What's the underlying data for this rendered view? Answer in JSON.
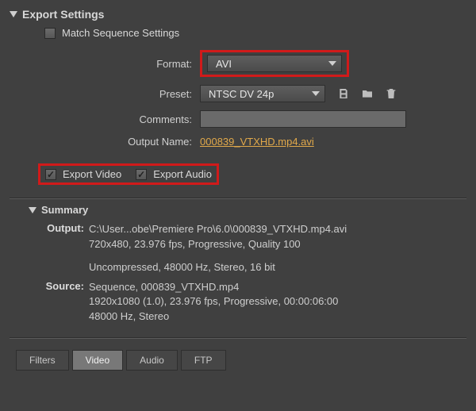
{
  "header": {
    "title": "Export Settings"
  },
  "matchSequence": {
    "label": "Match Sequence Settings",
    "checked": false
  },
  "format": {
    "label": "Format:",
    "value": "AVI"
  },
  "preset": {
    "label": "Preset:",
    "value": "NTSC DV 24p"
  },
  "presetIcons": {
    "save": "save-preset-icon",
    "import": "import-preset-icon",
    "delete": "delete-preset-icon"
  },
  "comments": {
    "label": "Comments:",
    "value": ""
  },
  "outputName": {
    "label": "Output Name:",
    "value": "000839_VTXHD.mp4.avi"
  },
  "exportVideo": {
    "label": "Export Video",
    "checked": true
  },
  "exportAudio": {
    "label": "Export Audio",
    "checked": true
  },
  "summary": {
    "title": "Summary",
    "output": {
      "key": "Output:",
      "line1": "C:\\User...obe\\Premiere Pro\\6.0\\000839_VTXHD.mp4.avi",
      "line2": "720x480, 23.976 fps, Progressive, Quality 100",
      "line3": "Uncompressed, 48000 Hz, Stereo, 16 bit"
    },
    "source": {
      "key": "Source:",
      "line1": "Sequence, 000839_VTXHD.mp4",
      "line2": "1920x1080 (1.0), 23.976 fps, Progressive, 00:00:06:00",
      "line3": "48000 Hz, Stereo"
    }
  },
  "tabs": {
    "items": [
      {
        "label": "Filters",
        "active": false
      },
      {
        "label": "Video",
        "active": true
      },
      {
        "label": "Audio",
        "active": false
      },
      {
        "label": "FTP",
        "active": false
      }
    ]
  }
}
